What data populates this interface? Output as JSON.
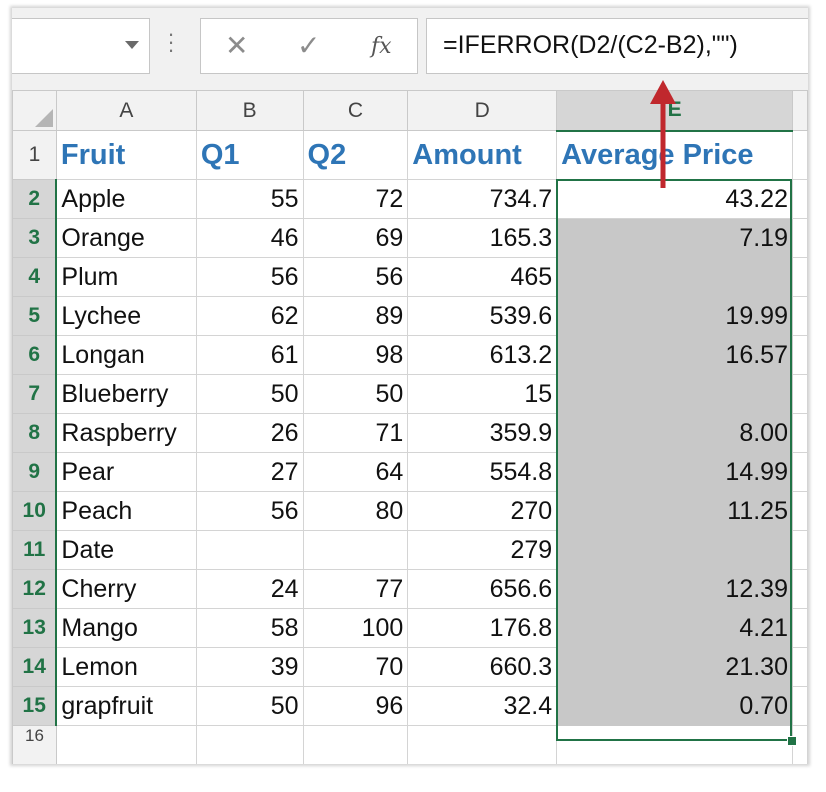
{
  "formula_bar": {
    "name_box_value": "",
    "cancel_glyph": "✕",
    "enter_glyph": "✓",
    "fx_label": "fx",
    "formula": "=IFERROR(D2/(C2-B2),\"\")"
  },
  "columns": [
    "A",
    "B",
    "C",
    "D",
    "E"
  ],
  "headers": {
    "fruit": "Fruit",
    "q1": "Q1",
    "q2": "Q2",
    "amount": "Amount",
    "avg": "Average Price"
  },
  "rows": [
    {
      "n": "2",
      "fruit": "Apple",
      "q1": "55",
      "q2": "72",
      "amount": "734.7",
      "avg": "43.22"
    },
    {
      "n": "3",
      "fruit": "Orange",
      "q1": "46",
      "q2": "69",
      "amount": "165.3",
      "avg": "7.19"
    },
    {
      "n": "4",
      "fruit": "Plum",
      "q1": "56",
      "q2": "56",
      "amount": "465",
      "avg": ""
    },
    {
      "n": "5",
      "fruit": "Lychee",
      "q1": "62",
      "q2": "89",
      "amount": "539.6",
      "avg": "19.99"
    },
    {
      "n": "6",
      "fruit": "Longan",
      "q1": "61",
      "q2": "98",
      "amount": "613.2",
      "avg": "16.57"
    },
    {
      "n": "7",
      "fruit": "Blueberry",
      "q1": "50",
      "q2": "50",
      "amount": "15",
      "avg": ""
    },
    {
      "n": "8",
      "fruit": "Raspberry",
      "q1": "26",
      "q2": "71",
      "amount": "359.9",
      "avg": "8.00"
    },
    {
      "n": "9",
      "fruit": "Pear",
      "q1": "27",
      "q2": "64",
      "amount": "554.8",
      "avg": "14.99"
    },
    {
      "n": "10",
      "fruit": "Peach",
      "q1": "56",
      "q2": "80",
      "amount": "270",
      "avg": "11.25"
    },
    {
      "n": "11",
      "fruit": "Date",
      "q1": "",
      "q2": "",
      "amount": "279",
      "avg": ""
    },
    {
      "n": "12",
      "fruit": "Cherry",
      "q1": "24",
      "q2": "77",
      "amount": "656.6",
      "avg": "12.39"
    },
    {
      "n": "13",
      "fruit": "Mango",
      "q1": "58",
      "q2": "100",
      "amount": "176.8",
      "avg": "4.21"
    },
    {
      "n": "14",
      "fruit": "Lemon",
      "q1": "39",
      "q2": "70",
      "amount": "660.3",
      "avg": "21.30"
    },
    {
      "n": "15",
      "fruit": "grapfruit",
      "q1": "50",
      "q2": "96",
      "amount": "32.4",
      "avg": "0.70"
    }
  ],
  "row_numbers": {
    "header_row": "1",
    "last_partial": "16"
  },
  "colors": {
    "header_text": "#2e75b6",
    "selection": "#217346",
    "annotation_arrow": "#c0282d"
  }
}
